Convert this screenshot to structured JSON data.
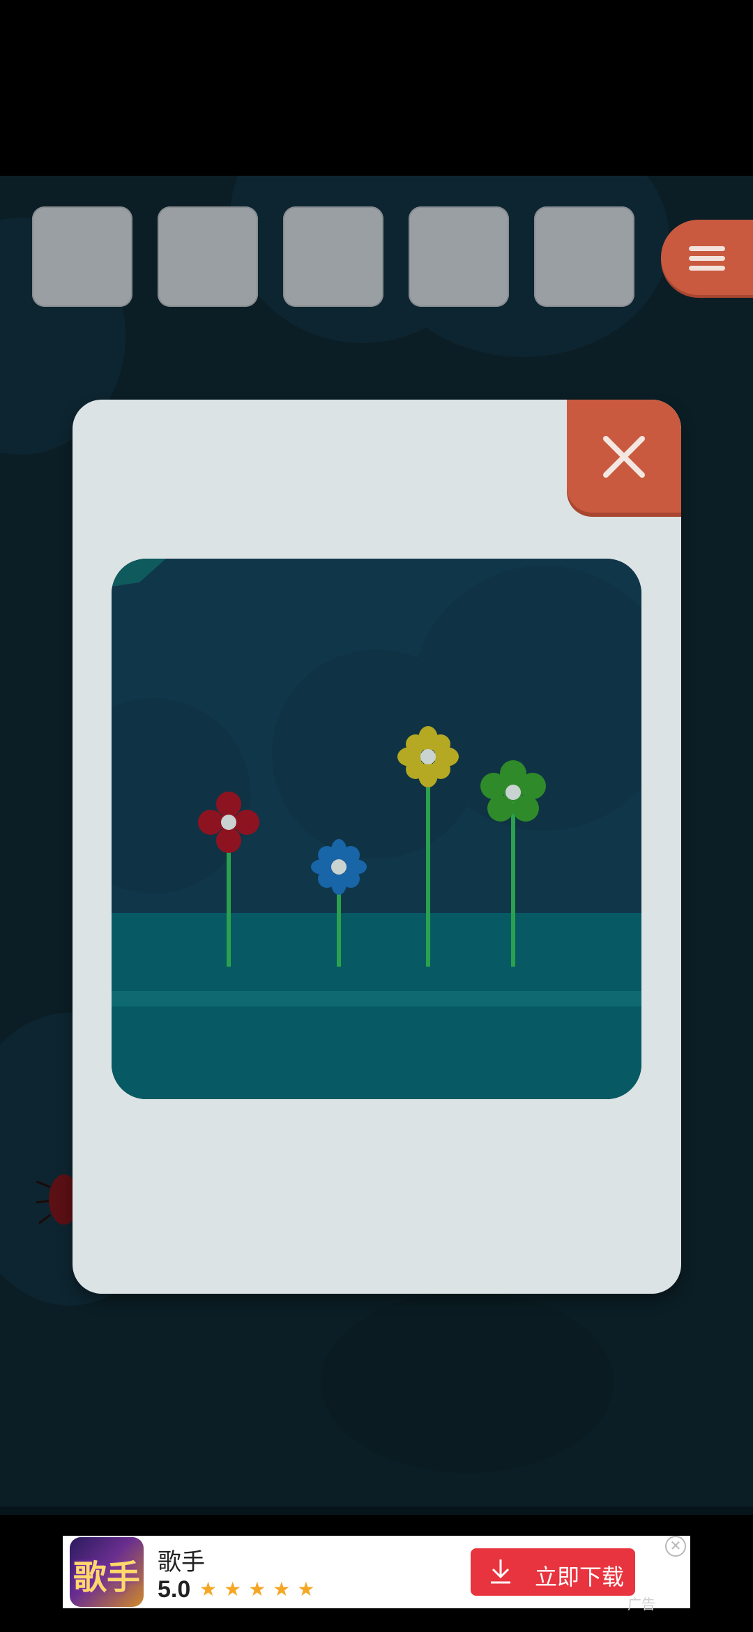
{
  "game": {
    "inventory_slots": 5,
    "menu_icon": "hamburger-menu-icon",
    "dialog": {
      "close_icon": "close-x-icon",
      "scene": {
        "flowers": [
          {
            "color": "#8e1321",
            "name": "red-flower"
          },
          {
            "color": "#1865a8",
            "name": "blue-flower"
          },
          {
            "color": "#b5a823",
            "name": "yellow-flower"
          },
          {
            "color": "#2f8a2a",
            "name": "green-flower"
          }
        ]
      }
    }
  },
  "ad": {
    "icon_text": "歌手",
    "title": "歌手",
    "rating": "5.0",
    "stars": "★★★★★",
    "cta_label": "立即下载",
    "close_symbol": "✕",
    "ad_label": "广告",
    "cta_color": "#e8343f"
  }
}
